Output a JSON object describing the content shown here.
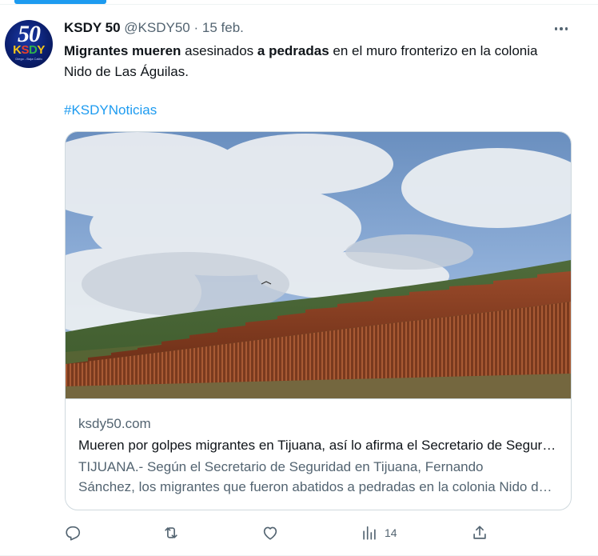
{
  "account": {
    "name": "KSDY 50",
    "handle": "@KSDY50",
    "separator": "·",
    "date": "15 feb.",
    "avatar_number": "50",
    "avatar_letters": [
      "K",
      "S",
      "D",
      "Y"
    ],
    "avatar_tagline": "Diego - Baja Califo"
  },
  "tweet": {
    "segments": [
      {
        "text": "Migrantes mueren",
        "bold": true
      },
      {
        "text": " asesinados ",
        "bold": false
      },
      {
        "text": "a pedradas",
        "bold": true
      },
      {
        "text": " en el muro fronterizo en la colonia Nido de Las Águilas.",
        "bold": false
      }
    ],
    "hashtag": "#KSDYNoticias"
  },
  "card": {
    "domain": "ksdy50.com",
    "title": "Mueren por golpes migrantes en Tijuana, así lo afirma el Secretario de Seguridad",
    "description_line1": "TIJUANA.- Según el Secretario de Seguridad en Tijuana, Fernando",
    "description_line2": "Sánchez, los migrantes que fueron abatidos a pedradas en la colonia Nido de Las Águilas"
  },
  "actions": {
    "reply_count": "",
    "retweet_count": "",
    "like_count": "",
    "views_count": "14"
  },
  "icons": {
    "more": "more-horizontal-icon",
    "reply": "reply-icon",
    "retweet": "retweet-icon",
    "like": "heart-icon",
    "views": "views-chart-icon",
    "share": "share-icon"
  },
  "colors": {
    "accent": "#1d9bf0",
    "text": "#0f1419",
    "muted": "#536471",
    "border": "#cfd9de"
  }
}
